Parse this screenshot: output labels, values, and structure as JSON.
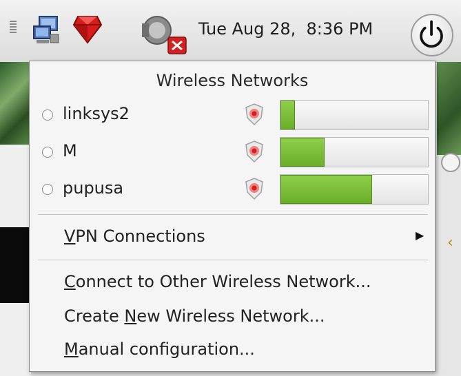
{
  "panel": {
    "clock": "Tue Aug 28,  8:36 PM",
    "icons": [
      "network-icon",
      "ruby-icon",
      "volume-muted-icon",
      "power-icon"
    ]
  },
  "menu": {
    "title": "Wireless Networks",
    "networks": [
      {
        "name": "linksys2",
        "signal_percent": 10,
        "secured": true
      },
      {
        "name": "M",
        "signal_percent": 30,
        "secured": true
      },
      {
        "name": "pupusa",
        "signal_percent": 62,
        "secured": true
      }
    ],
    "vpn": {
      "mnemonic": "V",
      "rest": "PN Connections"
    },
    "connect_other": {
      "mnemonic": "C",
      "rest": "onnect to Other Wireless Network..."
    },
    "create_new": {
      "pre": "Create ",
      "mnemonic": "N",
      "rest": "ew Wireless Network..."
    },
    "manual": {
      "mnemonic": "M",
      "rest": "anual configuration..."
    }
  },
  "colors": {
    "signal_fill": "#7fbf3a",
    "menu_bg": "#f5f5f5"
  }
}
